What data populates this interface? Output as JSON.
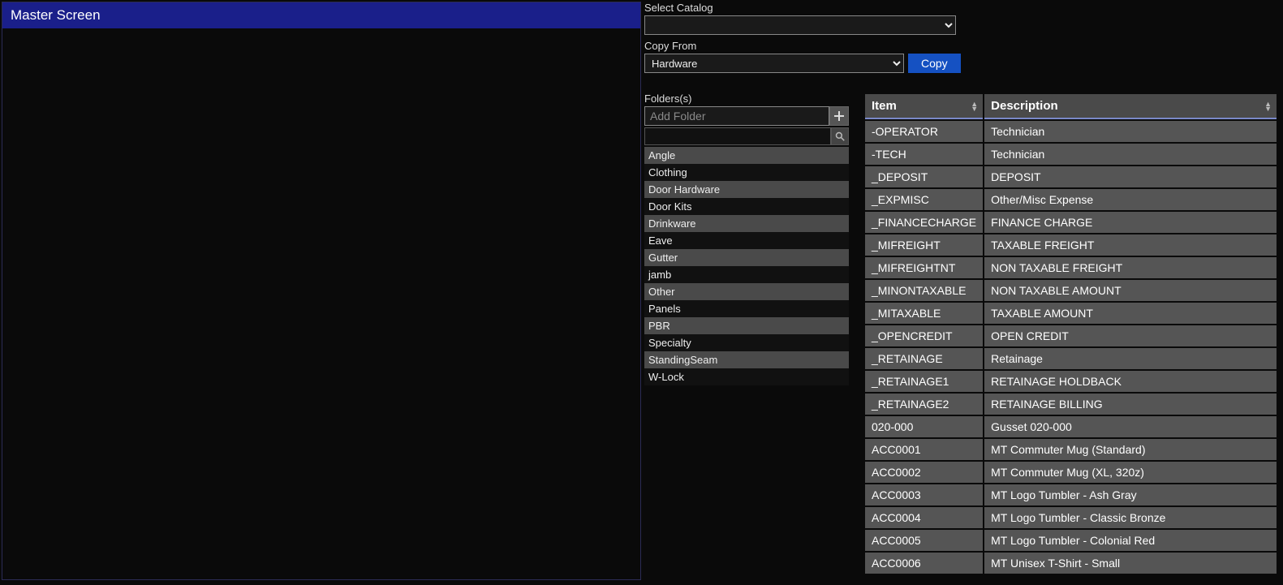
{
  "leftPanel": {
    "title": "Master Screen"
  },
  "selectCatalog": {
    "label": "Select Catalog",
    "value": ""
  },
  "copyFrom": {
    "label": "Copy From",
    "value": "Hardware",
    "buttonLabel": "Copy"
  },
  "folders": {
    "label": "Folders(s)",
    "addPlaceholder": "Add Folder",
    "list": [
      "Angle",
      "Clothing",
      "Door Hardware",
      "Door Kits",
      "Drinkware",
      "Eave",
      "Gutter",
      "jamb",
      "Other",
      "Panels",
      "PBR",
      "Specialty",
      "StandingSeam",
      "W-Lock"
    ]
  },
  "itemsTable": {
    "headers": {
      "item": "Item",
      "description": "Description"
    },
    "rows": [
      {
        "item": "-OPERATOR",
        "description": "Technician"
      },
      {
        "item": "-TECH",
        "description": "Technician"
      },
      {
        "item": "_DEPOSIT",
        "description": "DEPOSIT"
      },
      {
        "item": "_EXPMISC",
        "description": "Other/Misc Expense"
      },
      {
        "item": "_FINANCECHARGE",
        "description": "FINANCE CHARGE"
      },
      {
        "item": "_MIFREIGHT",
        "description": "TAXABLE FREIGHT"
      },
      {
        "item": "_MIFREIGHTNT",
        "description": "NON TAXABLE FREIGHT"
      },
      {
        "item": "_MINONTAXABLE",
        "description": "NON TAXABLE AMOUNT"
      },
      {
        "item": "_MITAXABLE",
        "description": "TAXABLE AMOUNT"
      },
      {
        "item": "_OPENCREDIT",
        "description": "OPEN CREDIT"
      },
      {
        "item": "_RETAINAGE",
        "description": "Retainage"
      },
      {
        "item": "_RETAINAGE1",
        "description": "RETAINAGE HOLDBACK"
      },
      {
        "item": "_RETAINAGE2",
        "description": "RETAINAGE BILLING"
      },
      {
        "item": "020-000",
        "description": "Gusset 020-000"
      },
      {
        "item": "ACC0001",
        "description": "MT Commuter Mug (Standard)"
      },
      {
        "item": "ACC0002",
        "description": "MT Commuter Mug (XL, 320z)"
      },
      {
        "item": "ACC0003",
        "description": "MT Logo Tumbler - Ash Gray"
      },
      {
        "item": "ACC0004",
        "description": "MT Logo Tumbler - Classic Bronze"
      },
      {
        "item": "ACC0005",
        "description": "MT Logo Tumbler - Colonial Red"
      },
      {
        "item": "ACC0006",
        "description": "MT Unisex T-Shirt - Small"
      }
    ]
  }
}
